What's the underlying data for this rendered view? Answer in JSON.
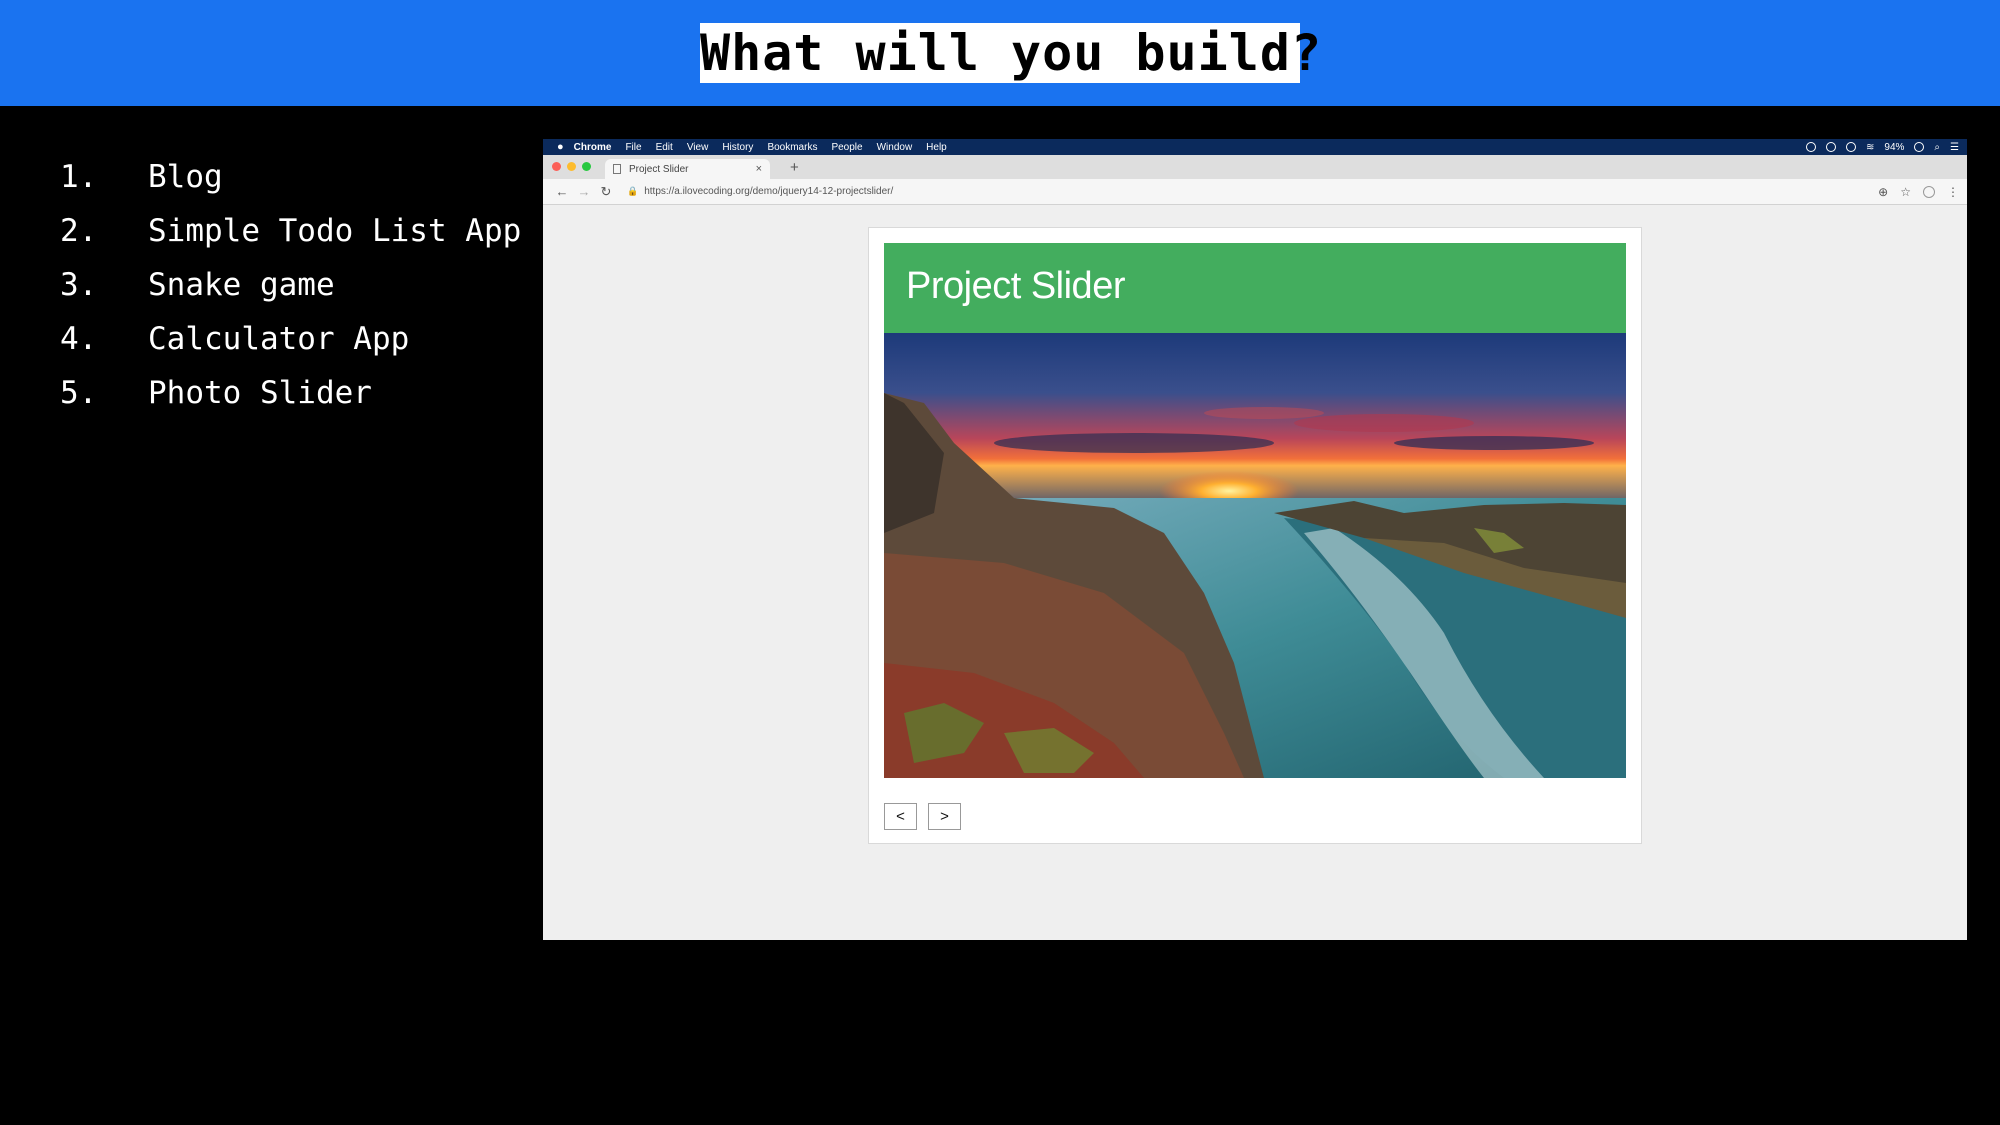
{
  "slide": {
    "title": "What will you build?"
  },
  "projects": [
    {
      "num": "1.",
      "label": "Blog"
    },
    {
      "num": "2.",
      "label": "Simple Todo List App"
    },
    {
      "num": "3.",
      "label": "Snake game"
    },
    {
      "num": "4.",
      "label": "Calculator App"
    },
    {
      "num": "5.",
      "label": "Photo Slider"
    }
  ],
  "browser": {
    "menubar": {
      "app": "Chrome",
      "items": [
        "File",
        "Edit",
        "View",
        "History",
        "Bookmarks",
        "People",
        "Window",
        "Help"
      ],
      "battery": "94%"
    },
    "tab": {
      "title": "Project Slider",
      "close": "×",
      "new_tab": "+"
    },
    "address": {
      "url": "https://a.ilovecoding.org/demo/jquery14-12-projectslider/"
    },
    "nav": {
      "back": "←",
      "forward": "→",
      "reload": "↻"
    }
  },
  "slider": {
    "title": "Project Slider",
    "prev_label": "<",
    "next_label": ">"
  },
  "colors": {
    "banner": "#1a73f0",
    "slider_header": "#43ad5e"
  }
}
